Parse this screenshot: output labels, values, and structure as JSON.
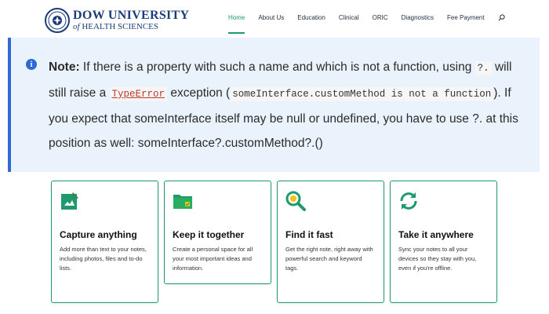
{
  "logo": {
    "line1": "DOW UNIVERSITY",
    "line2_prefix": "of",
    "line2": "HEALTH SCIENCES"
  },
  "nav": {
    "items": [
      "Home",
      "About Us",
      "Education",
      "Clinical",
      "ORIC",
      "Diagnostics",
      "Fee Payment"
    ],
    "active": "Home",
    "search_icon": "search-icon"
  },
  "note": {
    "label": "Note:",
    "text1": " If there is a property with such a name and which is not a function, using ",
    "code1": "?.",
    "text2": " will still raise a ",
    "code2": "TypeError",
    "text3": " exception (",
    "code3": "someInterface.customMethod is not a function",
    "text4": "). If you expect that someInterface itself may be null or undefined, you have to use ?. at this position as well: someInterface?.customMethod?.()"
  },
  "cards": [
    {
      "icon": "pen-note-icon",
      "title": "Capture anything",
      "desc": "Add more than text to your notes, including photos, files and to-do lists."
    },
    {
      "icon": "folder-check-icon",
      "title": "Keep it together",
      "desc": "Create a personal space for all your most important ideas and information."
    },
    {
      "icon": "magnifier-icon",
      "title": "Find it fast",
      "desc": "Get the right note, right away with powerful search and keyword tags."
    },
    {
      "icon": "sync-icon",
      "title": "Take it anywhere",
      "desc": "Sync your notes to all your devices so they stay with you, even if you're offline."
    }
  ],
  "colors": {
    "accent": "#1e9a6e",
    "note_bg": "#eaf2fb",
    "note_border": "#2e6ad6",
    "brand": "#1b3d7a"
  }
}
